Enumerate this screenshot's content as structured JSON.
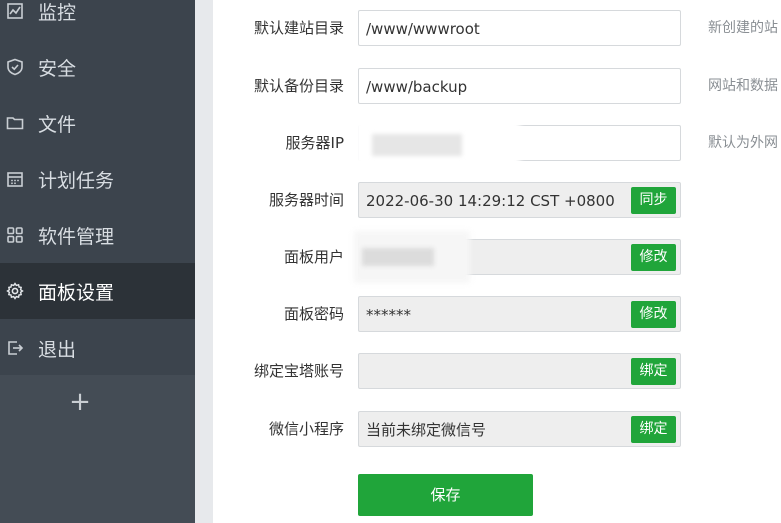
{
  "sidebar": {
    "items": [
      {
        "label": "监控",
        "icon": "monitor-icon"
      },
      {
        "label": "安全",
        "icon": "shield-icon"
      },
      {
        "label": "文件",
        "icon": "folder-icon"
      },
      {
        "label": "计划任务",
        "icon": "calendar-icon"
      },
      {
        "label": "软件管理",
        "icon": "grid-icon"
      },
      {
        "label": "面板设置",
        "icon": "gear-icon",
        "active": true
      },
      {
        "label": "退出",
        "icon": "logout-icon"
      }
    ],
    "add_label": "+"
  },
  "form": {
    "site_dir": {
      "label": "默认建站目录",
      "value": "/www/wwwroot",
      "help": "新创建的站"
    },
    "backup_dir": {
      "label": "默认备份目录",
      "value": "/www/backup",
      "help": "网站和数据"
    },
    "server_ip": {
      "label": "服务器IP",
      "value": "",
      "help": "默认为外网"
    },
    "server_time": {
      "label": "服务器时间",
      "value": "2022-06-30 14:29:12 CST +0800",
      "button": "同步"
    },
    "panel_user": {
      "label": "面板用户",
      "value": "",
      "button": "修改"
    },
    "panel_password": {
      "label": "面板密码",
      "value": "******",
      "button": "修改"
    },
    "bind_account": {
      "label": "绑定宝塔账号",
      "value": "",
      "button": "绑定"
    },
    "wechat": {
      "label": "微信小程序",
      "value": "当前未绑定微信号",
      "button": "绑定"
    }
  },
  "save_label": "保存",
  "colors": {
    "sidebar": "#3c444d",
    "active": "#2c3238",
    "accent": "#20a53a"
  }
}
